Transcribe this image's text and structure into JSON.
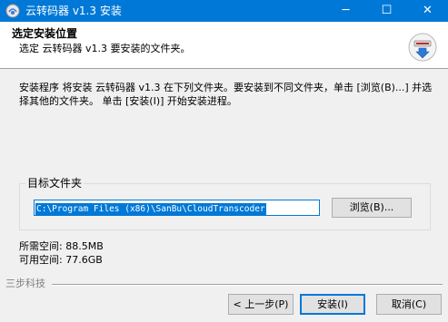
{
  "window": {
    "title": "云转码器 v1.3 安装",
    "minimize_glyph": "─",
    "maximize_glyph": "☐",
    "close_glyph": "✕",
    "titlebar_color": "#0078d7"
  },
  "header": {
    "title": "选定安装位置",
    "subtitle": "选定 云转码器 v1.3 要安装的文件夹。",
    "icon": "installer-box-icon"
  },
  "description": "安装程序 将安装 云转码器 v1.3 在下列文件夹。要安装到不同文件夹，单击 [浏览(B)...] 并选择其他的文件夹。 单击 [安装(I)] 开始安装进程。",
  "destination": {
    "group_label": "目标文件夹",
    "path_value": "C:\\Program Files (x86)\\SanBu\\CloudTranscoder",
    "browse_label": "浏览(B)..."
  },
  "space": {
    "required_label": "所需空间:",
    "required_value": "88.5MB",
    "available_label": "可用空间:",
    "available_value": "77.6GB"
  },
  "footer": {
    "brand": "三步科技",
    "back_label": "< 上一步(P)",
    "install_label": "安装(I)",
    "cancel_label": "取消(C)"
  }
}
